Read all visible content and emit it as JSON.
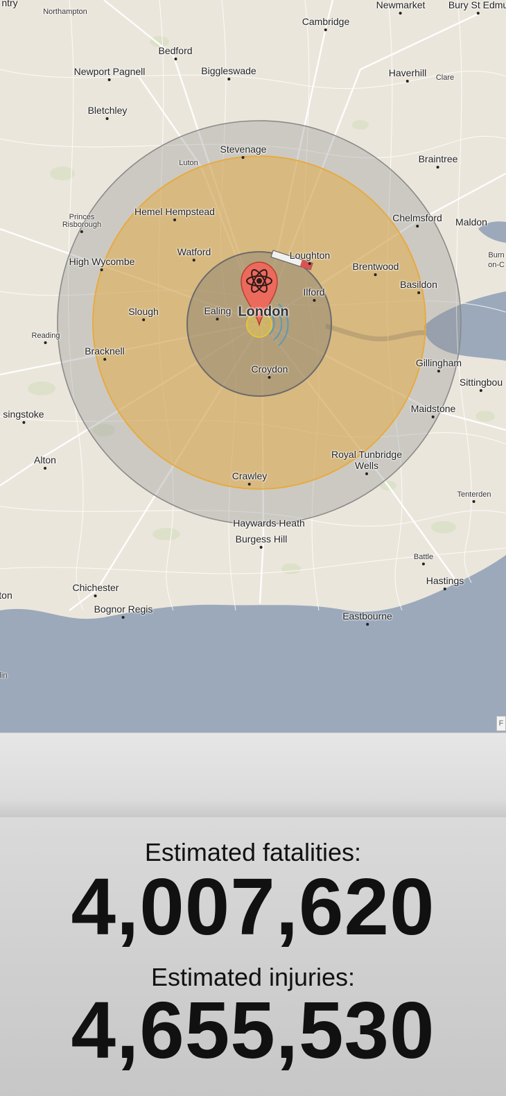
{
  "map": {
    "places": [
      {
        "id": "northampton",
        "name": "Northampton",
        "size": "small"
      },
      {
        "id": "newmarket",
        "name": "Newmarket",
        "size": "med"
      },
      {
        "id": "bury-st-edmunds",
        "name": "Bury St Edmu",
        "size": "med"
      },
      {
        "id": "cambridge",
        "name": "Cambridge",
        "size": "med"
      },
      {
        "id": "bedford",
        "name": "Bedford",
        "size": "med"
      },
      {
        "id": "newport-pagnell",
        "name": "Newport Pagnell",
        "size": "med"
      },
      {
        "id": "biggleswade",
        "name": "Biggleswade",
        "size": "med"
      },
      {
        "id": "haverhill",
        "name": "Haverhill",
        "size": "med"
      },
      {
        "id": "clare",
        "name": "Clare",
        "size": "small"
      },
      {
        "id": "bletchley",
        "name": "Bletchley",
        "size": "med"
      },
      {
        "id": "stevenage",
        "name": "Stevenage",
        "size": "med"
      },
      {
        "id": "luton",
        "name": "Luton",
        "size": "small"
      },
      {
        "id": "braintree",
        "name": "Braintree",
        "size": "med"
      },
      {
        "id": "princes-risborough-1",
        "name": "Princes",
        "size": "small"
      },
      {
        "id": "princes-risborough-2",
        "name": "Risborough",
        "size": "small"
      },
      {
        "id": "hemel-hempstead",
        "name": "Hemel Hempstead",
        "size": "med"
      },
      {
        "id": "chelmsford",
        "name": "Chelmsford",
        "size": "med"
      },
      {
        "id": "maldon",
        "name": "Maldon",
        "size": "med"
      },
      {
        "id": "burnham",
        "name": "Burn",
        "size": "small"
      },
      {
        "id": "on-crouch",
        "name": "on-C",
        "size": "small"
      },
      {
        "id": "watford",
        "name": "Watford",
        "size": "med"
      },
      {
        "id": "loughton",
        "name": "Loughton",
        "size": "med"
      },
      {
        "id": "high-wycombe",
        "name": "High Wycombe",
        "size": "med"
      },
      {
        "id": "brentwood",
        "name": "Brentwood",
        "size": "med"
      },
      {
        "id": "basildon",
        "name": "Basildon",
        "size": "med"
      },
      {
        "id": "ilford",
        "name": "Ilford",
        "size": "med"
      },
      {
        "id": "slough",
        "name": "Slough",
        "size": "med"
      },
      {
        "id": "ealing",
        "name": "Ealing",
        "size": "med"
      },
      {
        "id": "london",
        "name": "London",
        "size": "city"
      },
      {
        "id": "reading",
        "name": "Reading",
        "size": "small"
      },
      {
        "id": "bracknell",
        "name": "Bracknell",
        "size": "med"
      },
      {
        "id": "gillingham",
        "name": "Gillingham",
        "size": "med"
      },
      {
        "id": "sittingbourne",
        "name": "Sittingbou",
        "size": "med"
      },
      {
        "id": "croydon",
        "name": "Croydon",
        "size": "med"
      },
      {
        "id": "basingstoke",
        "name": "singstoke",
        "size": "med"
      },
      {
        "id": "maidstone",
        "name": "Maidstone",
        "size": "med"
      },
      {
        "id": "alton",
        "name": "Alton",
        "size": "med"
      },
      {
        "id": "royal-tunbridge",
        "name": "Royal Tunbridge",
        "size": "med"
      },
      {
        "id": "wells",
        "name": "Wells",
        "size": "med"
      },
      {
        "id": "crawley",
        "name": "Crawley",
        "size": "med"
      },
      {
        "id": "tenterden",
        "name": "Tenterden",
        "size": "small"
      },
      {
        "id": "haywards-heath",
        "name": "Haywards Heath",
        "size": "med"
      },
      {
        "id": "burgess-hill",
        "name": "Burgess Hill",
        "size": "med"
      },
      {
        "id": "battle",
        "name": "Battle",
        "size": "small"
      },
      {
        "id": "hastings",
        "name": "Hastings",
        "size": "med"
      },
      {
        "id": "chichester",
        "name": "Chichester",
        "size": "med"
      },
      {
        "id": "bognor-regis",
        "name": "Bognor Regis",
        "size": "med"
      },
      {
        "id": "eastbourne",
        "name": "Eastbourne",
        "size": "med"
      },
      {
        "id": "edge-ntry",
        "name": "ntry",
        "size": "med"
      },
      {
        "id": "edge-ton",
        "name": "ton",
        "size": "med"
      },
      {
        "id": "edge-lin",
        "name": "lin",
        "size": "small"
      }
    ],
    "marker_icon": "atom-pin-icon",
    "attribution_label": "F"
  },
  "results": {
    "fatalities_label": "Estimated fatalities:",
    "fatalities_value": "4,007,620",
    "injuries_label": "Estimated injuries:",
    "injuries_value": "4,655,530"
  },
  "colors": {
    "land": "#ebe6dc",
    "sea": "#9ba9bb",
    "outer_ring": "#9a9a9a",
    "thermal_ring": "#e8a93a",
    "blast_ring": "#6e6e6e",
    "fireball": "#f3d34a",
    "marker": "#ec6a5c"
  }
}
